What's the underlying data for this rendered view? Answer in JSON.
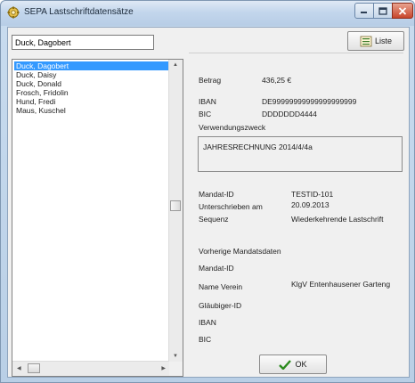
{
  "window": {
    "title": "SEPA Lastschriftdatensätze"
  },
  "search": {
    "value": "Duck, Dagobert"
  },
  "toolbar": {
    "liste_label": "Liste"
  },
  "list": {
    "items": [
      "Duck, Dagobert",
      "Duck, Daisy",
      "Duck, Donald",
      "Frosch, Fridolin",
      "Hund, Fredi",
      "Maus, Kuschel"
    ],
    "selected_index": 0
  },
  "details": {
    "betrag_label": "Betrag",
    "betrag_value": "436,25 €",
    "iban_label": "IBAN",
    "iban_value": "DE99999999999999999999",
    "bic_label": "BIC",
    "bic_value": "DDDDDDD4444",
    "verwendungszweck_label": "Verwendungszweck",
    "verwendungszweck_value": "JAHRESRECHNUNG 2014/4/4a",
    "mandat_id_label": "Mandat-ID",
    "mandat_id_value": "TESTID-101",
    "unterschrieben_label": "Unterschrieben am",
    "unterschrieben_value": "20.09.2013",
    "sequenz_label": "Sequenz",
    "sequenz_value": "Wiederkehrende Lastschrift",
    "vorherige_label": "Vorherige Mandatsdaten",
    "prev_mandat_id_label": "Mandat-ID",
    "name_verein_label": "Name Verein",
    "name_verein_value": "KlgV Entenhausener Garteng",
    "glaeubiger_label": "Gläubiger-ID",
    "prev_iban_label": "IBAN",
    "prev_bic_label": "BIC"
  },
  "footer": {
    "ok_label": "OK"
  },
  "colors": {
    "selection": "#3399ff",
    "ok_check": "#2a8a1c",
    "close_button": "#c8452b"
  }
}
